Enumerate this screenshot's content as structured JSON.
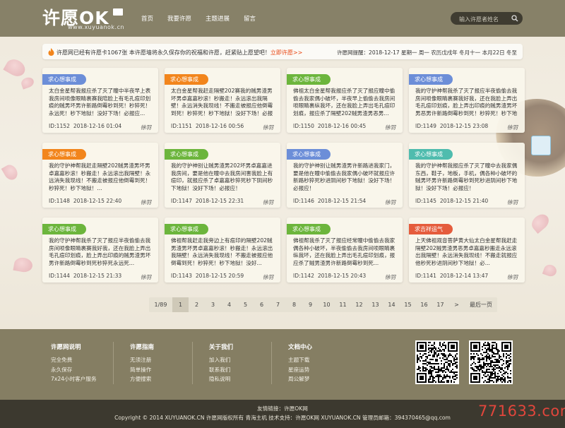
{
  "header": {
    "logo_text": "许愿OK",
    "logo_sub": "www.xuyuanok.cn",
    "nav": [
      "首页",
      "我要许愿",
      "主题进展",
      "留言"
    ],
    "search_placeholder": "输入许愿者姓名"
  },
  "notice": {
    "message": "许愿网已经有许愿卡1067张    本许愿墙将永久保存你的祝福和许愿，赶紧贴上愿望吧！",
    "link": "立即许愿>>",
    "date": "许愿网提醒：2018-12-17 星期一   周一 农历戊戌年 冬月十一 本月22日 冬至"
  },
  "cards": [
    {
      "tag": "求心想事成",
      "color": "blue",
      "text": "太白金星帮我报应杀了灭了瞳中半夜早上表我房间唢像眼睛裹赛我陪脸上有毛孔痘印划痕的贼男坏男许新路倒霉秒到死！秒猝死！永远死！秒下地狱！没好下场！必报应...",
      "id": "ID:1152",
      "date": "2018-12-16 01:04",
      "who": "徐羽"
    },
    {
      "tag": "求心想事成",
      "color": "orange",
      "text": "太白金星帮我赶走隔壁202赛我的贼男渣男坏男卓嘉嘉秒滚！秒搬走！永远滚出我隔壁！永远消失我现线！不搬走被报应他倒霉到死！秒猝死！秒下地狱！没好下场！必报应...",
      "id": "ID:1151",
      "date": "2018-12-16 00:56",
      "who": "徐羽"
    },
    {
      "tag": "求心想事成",
      "color": "green",
      "text": "佛祖太白金星帮我报应杀了灭了报应瞳中偷偷去我家偶小破坏，半夜早上偷偷去我房间唢眼睛裹纵我坏，还在我脸上弄出毛孔痘印划痕，报应杀了隔壁202贼男渣男恶男...",
      "id": "ID:1150",
      "date": "2018-12-16 00:45",
      "who": "徐羽"
    },
    {
      "tag": "求心想事成",
      "color": "blue",
      "text": "我的守护神帮我杀了灭了报应半夜偷偷去我房间唢像眼睛裹赛我好我，还在我脸上弄出毛孔痘印划痕，脸上弄出印痕的贼男渣男坏男恶男许新路倒霉秒到死！秒猝死！秒下地狱！没好下场！必报应...",
      "id": "ID:1149",
      "date": "2018-12-15 23:08",
      "who": "徐羽"
    },
    {
      "tag": "求心想事成",
      "color": "orange",
      "text": "我的守护神帮我赶走隔壁202贼男渣男坏男卓嘉嘉秒滚！秒搬走！永远滚出我隔壁！永远消失我现线！不搬走被报应他倒霉到死！秒猝死！秒下地狱！...",
      "id": "ID:1148",
      "date": "2018-12-15 22:40",
      "who": "徐羽"
    },
    {
      "tag": "求心想事成",
      "color": "green",
      "text": "我的守护神别让贼男渣男202坏男卓嘉嘉进我房间，要是他在瞳中去我房间害我脸上有痘印，就报应杀了卓嘉嘉秒猝死秒下阴间秒下地狱！没好下场！必报应！",
      "id": "ID:1147",
      "date": "2018-12-15 22:31",
      "who": "徐羽"
    },
    {
      "tag": "求心想事成",
      "color": "blue",
      "text": "我的守护神别让贼男渣男许新路进我家门，要是他在瞳中偷偷去我家偶小破坏就报应许新路秒猝死秒进阴间秒下地狱！没好下场！必报应！",
      "id": "ID:1146",
      "date": "2018-12-15 21:54",
      "who": "徐羽"
    },
    {
      "tag": "求心想事成",
      "color": "teal",
      "text": "我的守护神帮我报应杀了灭了瞳中去我家偶东西，鞋子，地板，手机，偶各种小破坏的贼男坏男许新路倒霉秒到死秒进阴间秒下地狱！没好下场！必报应！",
      "id": "ID:1145",
      "date": "2018-12-15 21:40",
      "who": "徐羽"
    },
    {
      "tag": "求心想事成",
      "color": "green",
      "text": "我的守护神帮我杀了灭了报应半夜偷偷去我房间唢像眼睛裹赛我好我，还在我脸上弄出毛孔痘印划痕，脸上弄出印痕的贼男渣男坏男许新路倒霉秒到死秒猝死永远死...",
      "id": "ID:1144",
      "date": "2018-12-15 21:33",
      "who": "徐羽"
    },
    {
      "tag": "求心想事成",
      "color": "green",
      "text": "佛祖帮我赶走我旁边上有痘印的隔壁202贼男渣男坏男卓嘉嘉秒滚！秒搬走！永远滚出我隔壁！永远消失我现线！不搬走被报应他倒霉到死！秒猝死！秒下地狱！没好...",
      "id": "ID:1143",
      "date": "2018-12-15 20:59",
      "who": "徐羽"
    },
    {
      "tag": "求心想事成",
      "color": "green",
      "text": "佛祖帮我杀了灭了报应经常瞳中偷偷去我家偶各种小破坏，半夜偷偷去我房间唢眼睛裹纵我坏，还在我脸上弄出毛孔痘印划痕，报应杀了贼男渣男许新路倒霉秒到死...",
      "id": "ID:1142",
      "date": "2018-12-15 20:43",
      "who": "徐羽"
    },
    {
      "tag": "求吉祥运气",
      "color": "red",
      "text": "上天佛祖观音菩萨黄大仙太白金星帮我赶走隔壁202贼男渣男恶男卓嘉嘉秒搬走永远滚出我隔壁！永远消失我现线！不搬走就报应他秒死秒进阴间秒下地狱！必...",
      "id": "ID:1141",
      "date": "2018-12-14 13:47",
      "who": "徐羽"
    }
  ],
  "pagination": {
    "info": "1/89",
    "pages": [
      "1",
      "2",
      "3",
      "4",
      "5",
      "6",
      "7",
      "8",
      "9",
      "10",
      "11",
      "12",
      "13",
      "14",
      "15",
      "16",
      "17"
    ],
    "current": "1",
    "next": ">",
    "last": "最后一页"
  },
  "footer": {
    "columns": [
      {
        "title": "许愿网说明",
        "items": [
          "完全免费",
          "永久保存",
          "7x24小时客户服务"
        ]
      },
      {
        "title": "许愿指南",
        "items": [
          "无须注册",
          "简单操作",
          "方便搜索"
        ]
      },
      {
        "title": "关于我们",
        "items": [
          "加入我们",
          "联系我们",
          "隐私说明"
        ]
      },
      {
        "title": "文档中心",
        "items": [
          "主题下载",
          "星座运势",
          "周公解梦"
        ]
      }
    ],
    "links": "友情链接：许愿OK网",
    "copyright": "Copyright © 2014 XUYUANOK.CN 许愿网版权所有 青海主机  技术支持：许愿OK网 XUYUANOK.CN  管理员邮箱：394370465@qq.com"
  },
  "watermark": "771633.com",
  "colors": {
    "header": "#878168",
    "footer": "#857e63",
    "bottom": "#3c392f",
    "accent": "#e8430e"
  }
}
